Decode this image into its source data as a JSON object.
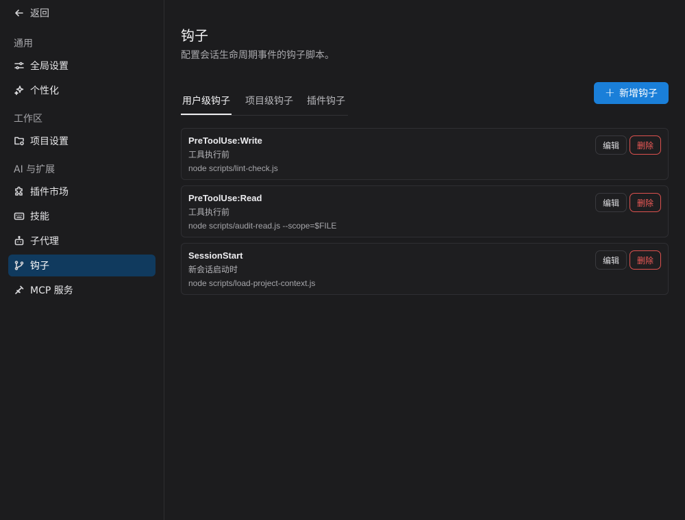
{
  "sidebar": {
    "back_label": "返回",
    "sections": [
      {
        "label": "通用",
        "items": [
          {
            "label": "全局设置",
            "icon": "sliders-icon"
          },
          {
            "label": "个性化",
            "icon": "sparkle-icon"
          }
        ]
      },
      {
        "label": "工作区",
        "items": [
          {
            "label": "项目设置",
            "icon": "folder-settings-icon"
          }
        ]
      },
      {
        "label": "AI 与扩展",
        "items": [
          {
            "label": "插件市场",
            "icon": "puzzle-icon"
          },
          {
            "label": "技能",
            "icon": "keyboard-icon"
          },
          {
            "label": "子代理",
            "icon": "robot-icon"
          },
          {
            "label": "钩子",
            "icon": "git-branch-icon",
            "active": true
          },
          {
            "label": "MCP 服务",
            "icon": "plug-icon"
          }
        ]
      }
    ]
  },
  "main": {
    "title": "钩子",
    "description": "配置会话生命周期事件的钩子脚本。",
    "tabs": [
      {
        "label": "用户级钩子",
        "active": true
      },
      {
        "label": "项目级钩子"
      },
      {
        "label": "插件钩子"
      }
    ],
    "add_button_label": "新增钩子",
    "hooks": [
      {
        "name": "PreToolUse:Write",
        "event": "工具执行前",
        "command": "node scripts/lint-check.js",
        "edit_label": "编辑",
        "delete_label": "删除"
      },
      {
        "name": "PreToolUse:Read",
        "event": "工具执行前",
        "command": "node scripts/audit-read.js --scope=$FILE",
        "edit_label": "编辑",
        "delete_label": "删除"
      },
      {
        "name": "SessionStart",
        "event": "新会话启动时",
        "command": "node scripts/load-project-context.js",
        "edit_label": "编辑",
        "delete_label": "删除"
      }
    ]
  },
  "colors": {
    "background": "#1c1c1e",
    "active_nav": "#103a5e",
    "primary": "#1a7fd9",
    "danger": "#ef5a57"
  }
}
